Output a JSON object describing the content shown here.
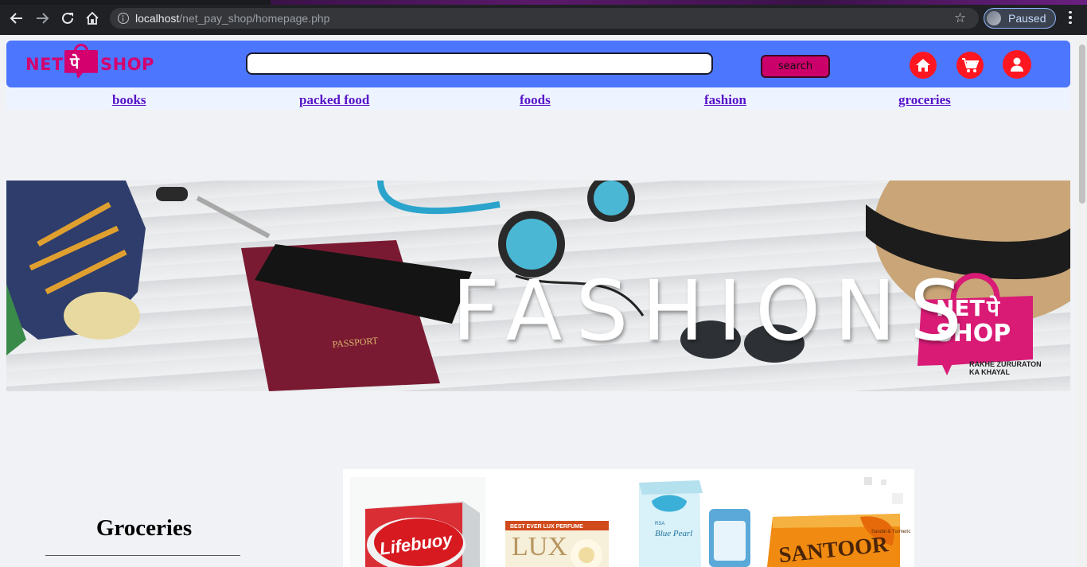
{
  "browser": {
    "url_host": "localhost",
    "url_path": "/net_pay_shop/homepage.php",
    "profile_status": "Paused"
  },
  "site": {
    "logo": {
      "left_text": "NET",
      "bag_text": "पे",
      "right_text": "SHOP"
    },
    "search": {
      "value": "",
      "button_label": "search"
    },
    "nav": [
      "books",
      "packed food",
      "foods",
      "fashion",
      "groceries"
    ]
  },
  "banner": {
    "headline": "FASHIONS",
    "logo_left": "NET",
    "logo_bag": "पे",
    "logo_right": "SHOP",
    "tagline_1": "RAKHE ZURURATON",
    "tagline_2": "KA KHAYAL",
    "passport_text": "PASSPORT"
  },
  "groceries": {
    "title": "Groceries",
    "products": [
      {
        "name": "Lifebuoy",
        "color": "#d71920"
      },
      {
        "name": "LUX",
        "color": "#c8a35a"
      },
      {
        "name": "Blue Pearl",
        "color": "#3ab0d8"
      },
      {
        "name": "SANTOOR",
        "color": "#f08a10"
      }
    ],
    "lux_tagline": "BEST EVER LUX PERFUME",
    "bluepearl_text": "Blue Pearl",
    "bluepearl_brand": "RSA",
    "santoor_sub": "Sandal & Turmeric"
  }
}
